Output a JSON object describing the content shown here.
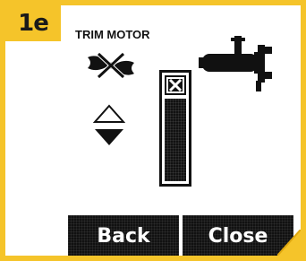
{
  "step_badge": "1e",
  "title": "TRIM MOTOR",
  "buttons": {
    "back_label": "Back",
    "close_label": "Close"
  },
  "icons": {
    "prop_disabled": "propeller-disabled-icon",
    "trim_up": "triangle-up-icon",
    "trim_down": "triangle-down-icon",
    "motor": "trolling-motor-icon",
    "cancel": "x-box-icon"
  },
  "trim_level": 0,
  "colors": {
    "accent": "#f5c42a",
    "screen_dark": "#111111"
  }
}
